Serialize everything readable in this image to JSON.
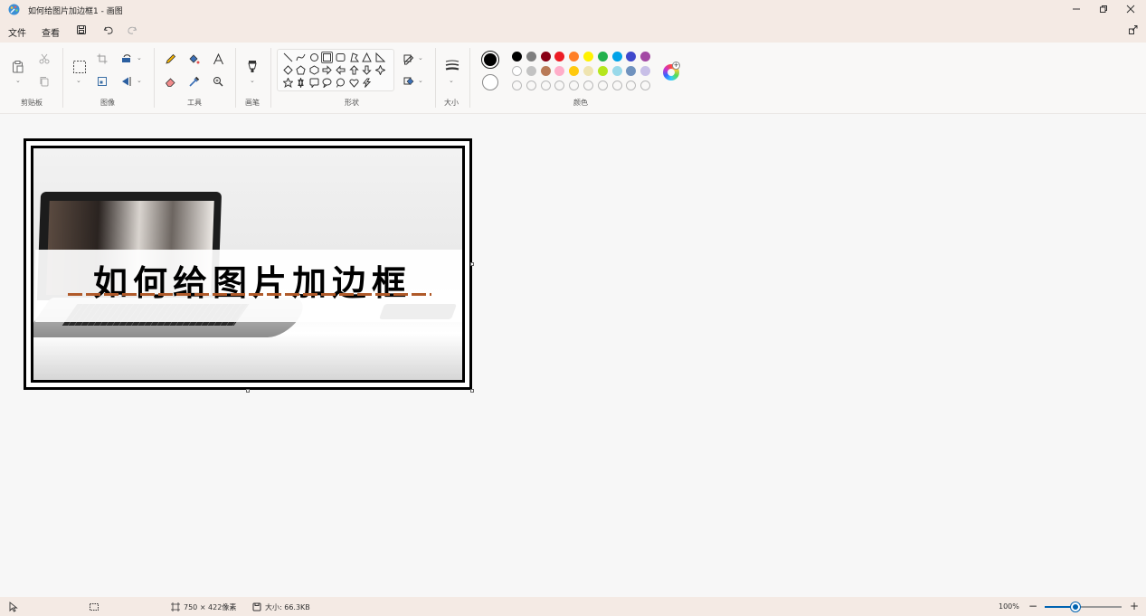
{
  "window": {
    "title": "如何给图片加边框1 - 画图",
    "app_icon": "paint-palette-icon",
    "controls": [
      "minimize-icon",
      "restore-icon",
      "close-icon"
    ]
  },
  "menu": {
    "file": "文件",
    "view": "查看",
    "quick_access": [
      "save-icon",
      "undo-icon",
      "redo-icon"
    ],
    "share_icon": "share-icon"
  },
  "ribbon": {
    "groups": {
      "clipboard": "剪贴板",
      "image": "图像",
      "tools": "工具",
      "brushes": "画笔",
      "shapes": "形状",
      "size": "大小",
      "colors": "颜色"
    },
    "tool_icons": [
      "paste-icon",
      "cut-icon",
      "copy-icon",
      "select-icon",
      "crop-icon",
      "resize-icon",
      "rotate-icon",
      "flip-icon",
      "pencil-icon",
      "fill-icon",
      "text-icon",
      "eraser-icon",
      "color-picker-icon",
      "magnifier-icon",
      "brush-icon",
      "outline-icon",
      "shape-fill-icon",
      "stroke-size-icon"
    ],
    "shapes": [
      "line",
      "curve",
      "oval",
      "rectangle",
      "rounded-rectangle",
      "polygon",
      "triangle",
      "right-triangle",
      "diamond",
      "pentagon",
      "hexagon",
      "right-arrow",
      "left-arrow",
      "up-arrow",
      "down-arrow",
      "four-point-star",
      "five-point-star",
      "six-point-star",
      "rounded-callout",
      "oval-callout",
      "cloud-callout",
      "heart",
      "lightning"
    ],
    "colors": {
      "primary": "#000000",
      "secondary": "#ffffff",
      "row1": [
        "#000000",
        "#7f7f7f",
        "#880015",
        "#ed1c24",
        "#ff7f27",
        "#fff200",
        "#22b14c",
        "#00a2e8",
        "#3f48cc",
        "#a349a4"
      ],
      "row2": [
        "#ffffff",
        "#c3c3c3",
        "#b97a57",
        "#ffaec9",
        "#ffc90e",
        "#efe4b0",
        "#b5e61d",
        "#99d9ea",
        "#7092be",
        "#c8bfe7"
      ]
    }
  },
  "canvas": {
    "image_text": "如何给图片加边框"
  },
  "status": {
    "pointer_icon": "pointer-icon",
    "selection_icon": "selection-icon",
    "dimensions": "750 × 422像素",
    "file_size": "大小: 66.3KB",
    "zoom": "100%",
    "zoom_level": 0.4
  }
}
